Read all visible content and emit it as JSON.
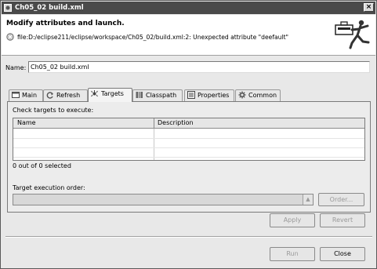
{
  "window": {
    "title": "Ch05_02 build.xml",
    "close_glyph": "×"
  },
  "header": {
    "title": "Modify attributes and launch.",
    "message": "file:D:/eclipse211/eclipse/workspace/Ch05_02/build.xml:2: Unexpected attribute \"deefault\"",
    "banner_icon": "ant-runner-icon"
  },
  "name_field": {
    "label": "Name:",
    "value": "Ch05_02 build.xml"
  },
  "tabs": [
    {
      "label": "Main",
      "icon": "main-tab-icon"
    },
    {
      "label": "Refresh",
      "icon": "refresh-icon"
    },
    {
      "label": "Targets",
      "icon": "targets-icon",
      "active": true
    },
    {
      "label": "Classpath",
      "icon": "classpath-icon"
    },
    {
      "label": "Properties",
      "icon": "properties-icon"
    },
    {
      "label": "Common",
      "icon": "common-icon"
    }
  ],
  "targets": {
    "check_label": "Check targets to execute:",
    "columns": [
      "Name",
      "Description"
    ],
    "selected_count": "0 out of 0 selected",
    "order_label": "Target execution order:",
    "order_button": "Order...",
    "combo_arrow": "▲"
  },
  "buttons": {
    "apply": "Apply",
    "revert": "Revert",
    "run": "Run",
    "close": "Close"
  }
}
